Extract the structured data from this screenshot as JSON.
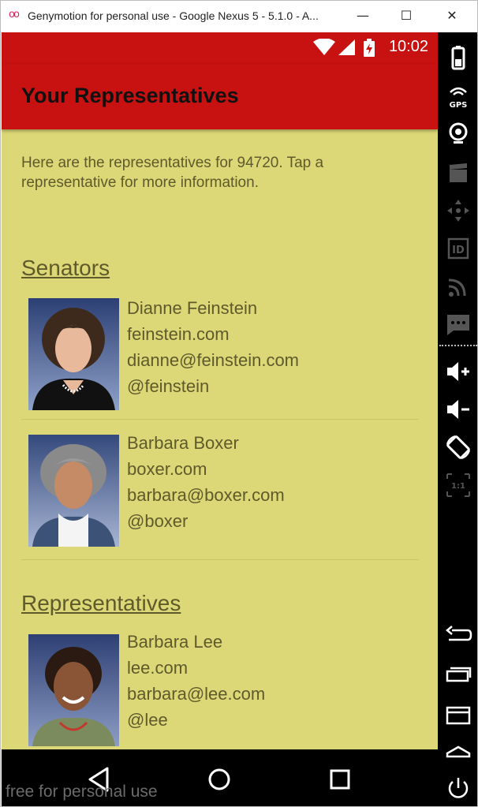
{
  "window": {
    "title": "Genymotion for personal use - Google Nexus 5 - 5.1.0 - A...",
    "minimize_glyph": "—",
    "maximize_glyph": "☐",
    "close_glyph": "✕",
    "app_icon_glyph": "oo"
  },
  "status_bar": {
    "time": "10:02"
  },
  "app_bar": {
    "title": "Your Representatives"
  },
  "intro_text": "Here are the representatives for 94720. Tap a representative for more information.",
  "sections": {
    "senators": {
      "title": "Senators",
      "people": [
        {
          "name": "Dianne Feinstein",
          "website": "feinstein.com",
          "email": "dianne@feinstein.com",
          "twitter": "@feinstein"
        },
        {
          "name": "Barbara Boxer",
          "website": "boxer.com",
          "email": "barbara@boxer.com",
          "twitter": "@boxer"
        }
      ]
    },
    "representatives": {
      "title": "Representatives",
      "people": [
        {
          "name": "Barbara Lee",
          "website": "lee.com",
          "email": "barbara@lee.com",
          "twitter": "@lee"
        }
      ]
    }
  },
  "watermark": "free for personal use",
  "colors": {
    "primary": "#c81111",
    "background": "#dcd877",
    "text": "#5e5a2c"
  },
  "sidebar_icons": [
    "battery-icon",
    "gps-icon",
    "webcam-icon",
    "screencast-icon",
    "dpad-icon",
    "device-id-icon",
    "network-icon",
    "sms-icon",
    "volume-up-icon",
    "volume-down-icon",
    "rotate-icon",
    "pixel-perfect-icon",
    "back-icon",
    "recent-apps-icon",
    "menu-icon",
    "home-icon",
    "power-icon"
  ],
  "sidebar_labels": {
    "gps": "GPS",
    "id": "ID",
    "pixel": "1:1"
  }
}
